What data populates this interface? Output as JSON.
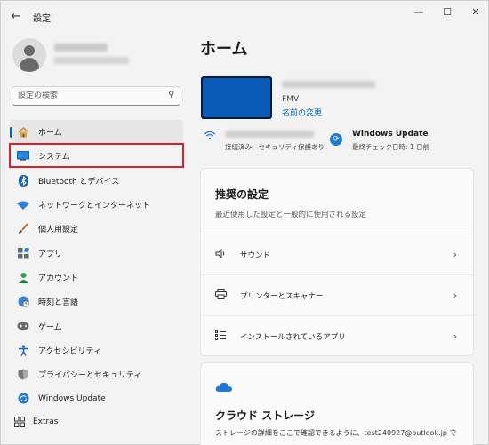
{
  "window": {
    "title": "設定"
  },
  "search": {
    "placeholder": "設定の検索"
  },
  "nav": [
    {
      "label": "ホーム",
      "icon": "home-icon"
    },
    {
      "label": "システム",
      "icon": "display-icon"
    },
    {
      "label": "Bluetooth とデバイス",
      "icon": "bluetooth-icon"
    },
    {
      "label": "ネットワークとインターネット",
      "icon": "network-icon"
    },
    {
      "label": "個人用設定",
      "icon": "brush-icon"
    },
    {
      "label": "アプリ",
      "icon": "apps-icon"
    },
    {
      "label": "アカウント",
      "icon": "account-icon"
    },
    {
      "label": "時刻と言語",
      "icon": "globe-icon"
    },
    {
      "label": "ゲーム",
      "icon": "game-icon"
    },
    {
      "label": "アクセシビリティ",
      "icon": "accessibility-icon"
    },
    {
      "label": "プライバシーとセキュリティ",
      "icon": "shield-icon"
    },
    {
      "label": "Windows Update",
      "icon": "update-icon"
    }
  ],
  "extras": {
    "label": "Extras"
  },
  "main": {
    "title": "ホーム",
    "device": {
      "model": "FMV",
      "rename": "名前の変更"
    },
    "network": {
      "status": "接続済み、セキュリティ保護あり"
    },
    "windows_update": {
      "title": "Windows Update",
      "status": "最終チェック日時: 1 日前"
    },
    "recommended": {
      "title": "推奨の設定",
      "subtitle": "最近使用した設定と一般的に使用される設定",
      "items": [
        {
          "label": "サウンド",
          "icon": "speaker-icon"
        },
        {
          "label": "プリンターとスキャナー",
          "icon": "printer-icon"
        },
        {
          "label": "インストールされているアプリ",
          "icon": "list-icon"
        }
      ]
    },
    "cloud": {
      "title": "クラウド ストレージ",
      "description": "ストレージの詳細をここで確認できるように、test240927@outlook.jp で"
    }
  },
  "colors": {
    "accent": "#005fb8",
    "highlight": "#d8212c"
  }
}
